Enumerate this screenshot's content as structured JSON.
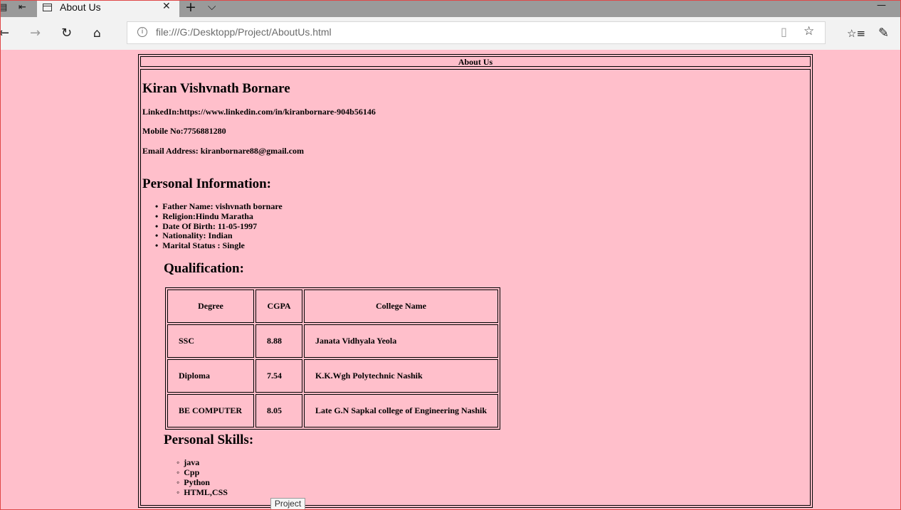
{
  "browser": {
    "tab_title": "About Us",
    "tab_close": "✕",
    "new_tab": "+",
    "tab_list": "⌵",
    "minimize": "—",
    "address": "file:///G:/Desktopp/Project/AboutUs.html",
    "icons": [
      "back-icon",
      "forward-icon",
      "refresh-icon",
      "home-icon",
      "reading-view-icon",
      "favorite-star-icon",
      "favorites-hub-icon",
      "pen-icon"
    ]
  },
  "page": {
    "header": "About Us",
    "name": "Kiran Vishvnath Bornare",
    "linkedin": "LinkedIn:https://www.linkedin.com/in/kiranbornare-904b56146",
    "mobile": "Mobile No:7756881280",
    "email": "Email Address: kiranbornare88@gmail.com",
    "personal_heading": "Personal Information:",
    "personal_items": [
      "Father Name: vishvnath bornare",
      "Religion:Hindu Maratha",
      "Date Of Birth: 11-05-1997",
      "Nationality: Indian",
      "Marital Status : Single"
    ],
    "qualification_heading": "Qualification:",
    "table": {
      "headers": [
        "Degree",
        "CGPA",
        "College Name"
      ],
      "rows": [
        [
          "SSC",
          "8.88",
          "Janata Vidhyala Yeola"
        ],
        [
          "Diploma",
          "7.54",
          "K.K.Wgh Polytechnic Nashik"
        ],
        [
          "BE COMPUTER",
          "8.05",
          "Late G.N Sapkal college of Engineering Nashik"
        ]
      ]
    },
    "skills_heading": "Personal Skills:",
    "skills": [
      "java",
      "Cpp",
      "Python",
      "HTML,CSS"
    ]
  },
  "tooltip": "Project",
  "colors": {
    "background": "#ffbfcb",
    "tabstrip": "#9a9a9a",
    "toolbar": "#f2f2f2",
    "window_border": "#e04848"
  }
}
